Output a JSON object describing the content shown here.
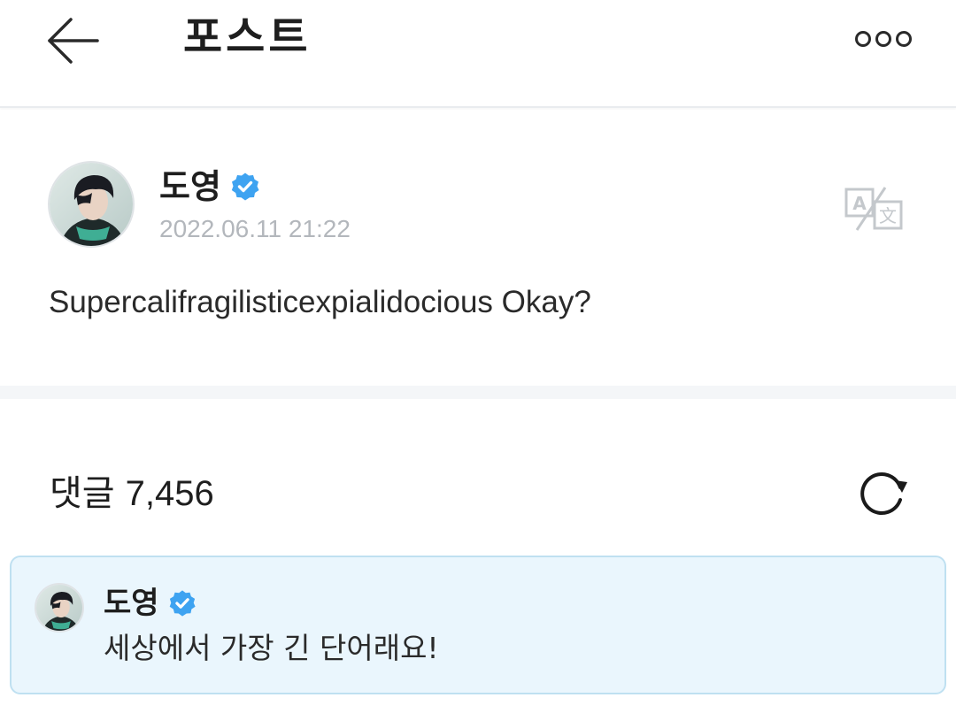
{
  "header": {
    "title": "포스트",
    "back_icon": "arrow-left-icon",
    "more_icon": "more-horizontal-icon"
  },
  "post": {
    "author_name": "도영",
    "verified_icon": "verified-badge-icon",
    "timestamp": "2022.06.11 21:22",
    "translate_icon": "translate-icon",
    "body": "Supercalifragilisticexpialidocious Okay?"
  },
  "comments": {
    "label": "댓글",
    "count": "7,456",
    "refresh_icon": "refresh-icon",
    "items": [
      {
        "author_name": "도영",
        "text": "세상에서 가장 긴 단어래요!"
      }
    ]
  },
  "colors": {
    "verified_blue": "#3ea3f1",
    "timestamp_gray": "#b3b7bc",
    "comment_card_bg": "#eaf6fd",
    "comment_card_border": "#bfe0f1"
  }
}
